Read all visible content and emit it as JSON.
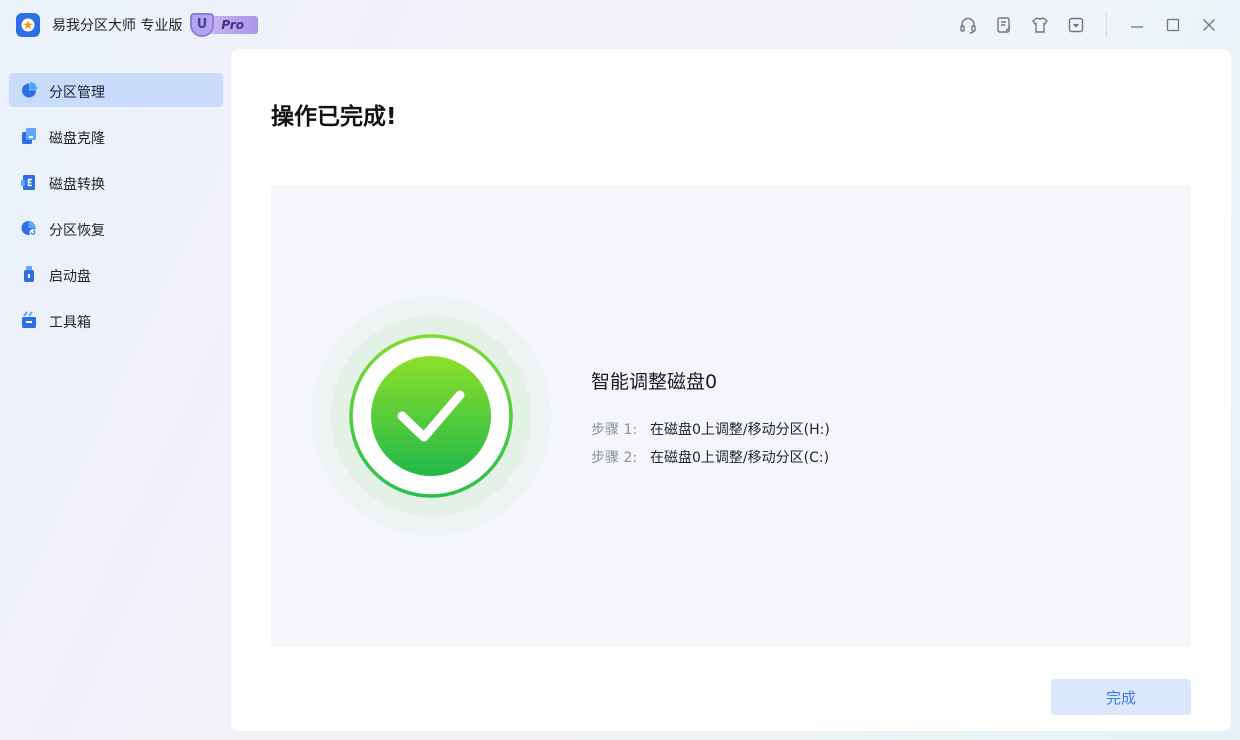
{
  "app": {
    "title": "易我分区大师 专业版",
    "badge_letter": "U",
    "badge_text": "Pro",
    "accent_color": "#2f6fe4"
  },
  "titlebar_icons": [
    "headset-icon",
    "feedback-icon",
    "theme-shirt-icon",
    "dropdown-menu-icon",
    "minimize-icon",
    "maximize-icon",
    "close-icon"
  ],
  "sidebar": {
    "items": [
      {
        "label": "分区管理",
        "icon": "partition-pie-icon",
        "active": true
      },
      {
        "label": "磁盘克隆",
        "icon": "disk-clone-icon",
        "active": false
      },
      {
        "label": "磁盘转换",
        "icon": "disk-convert-icon",
        "active": false
      },
      {
        "label": "分区恢复",
        "icon": "partition-recovery-icon",
        "active": false
      },
      {
        "label": "启动盘",
        "icon": "bootable-usb-icon",
        "active": false
      },
      {
        "label": "工具箱",
        "icon": "toolbox-icon",
        "active": false
      }
    ]
  },
  "main": {
    "title": "操作已完成!",
    "task": {
      "title": "智能调整磁盘0",
      "steps": [
        {
          "label": "步骤 1:",
          "text": "在磁盘0上调整/移动分区(H:)"
        },
        {
          "label": "步骤 2:",
          "text": "在磁盘0上调整/移动分区(C:)"
        }
      ]
    },
    "finish_button": "完成",
    "success_color": "#2fc047"
  }
}
